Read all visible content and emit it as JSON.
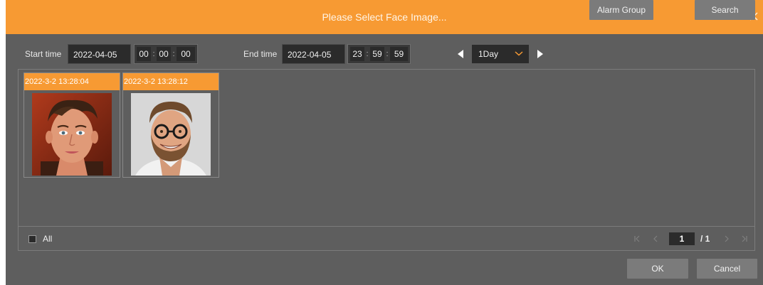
{
  "dialog": {
    "title": "Please Select Face Image..."
  },
  "filters": {
    "start_label": "Start time",
    "start_date": "2022-04-05",
    "start_hh": "00",
    "start_mm": "00",
    "start_ss": "00",
    "end_label": "End time",
    "end_date": "2022-04-05",
    "end_hh": "23",
    "end_mm": "59",
    "end_ss": "59",
    "range_value": "1Day",
    "alarm_group_label": "Alarm Group",
    "search_label": "Search"
  },
  "faces": [
    {
      "timestamp": "2022-3-2 13:28:04"
    },
    {
      "timestamp": "2022-3-2 13:28:12"
    }
  ],
  "footer": {
    "all_label": "All",
    "current_page": "1",
    "total_pages": "/ 1",
    "ok_label": "OK",
    "cancel_label": "Cancel"
  },
  "colors": {
    "accent": "#f79a33",
    "dialog_bg": "#5e5e5e",
    "field_bg": "#2b2b2b",
    "button_bg": "#7b7b7b"
  }
}
